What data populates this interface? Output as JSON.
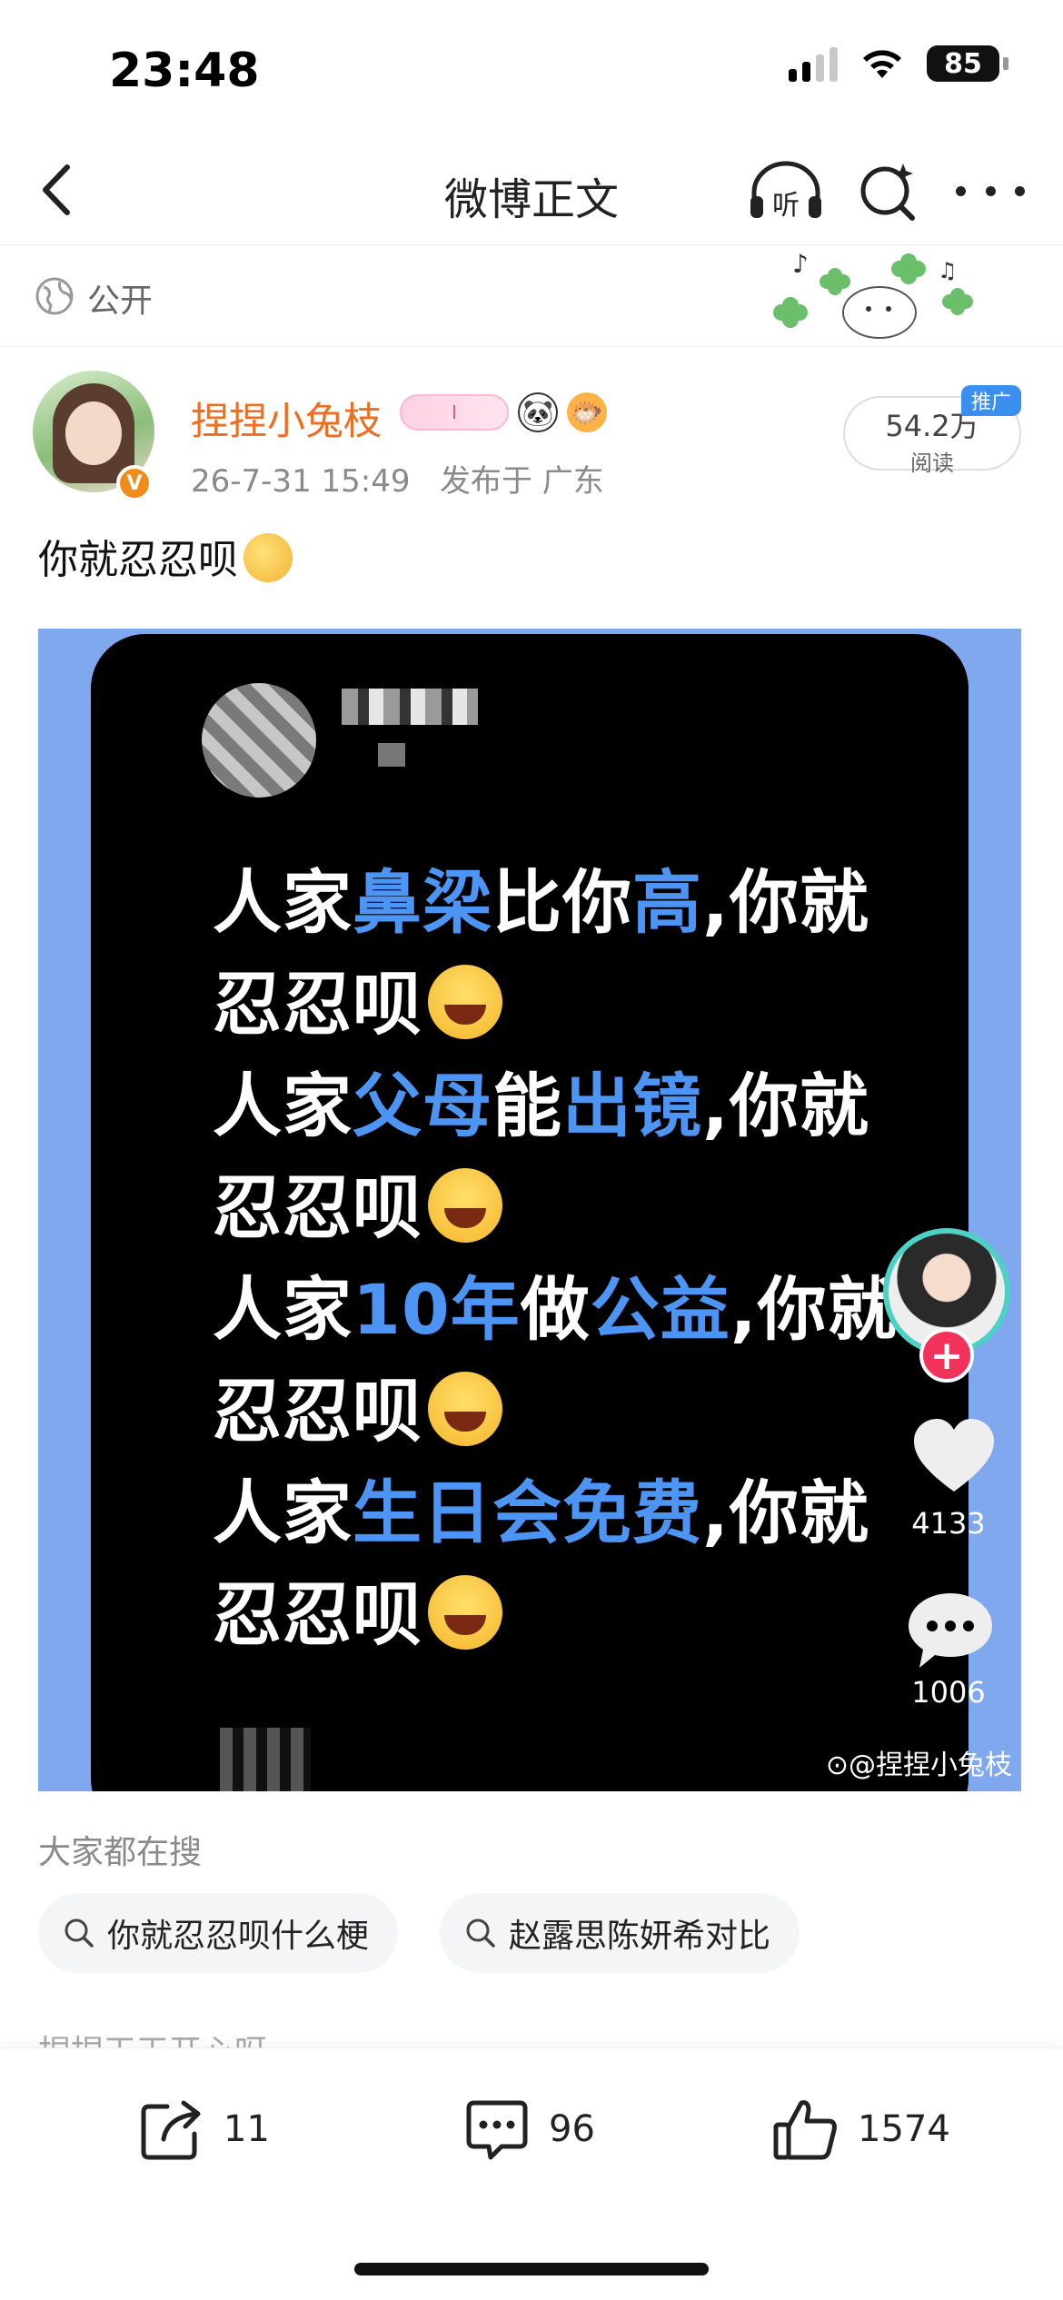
{
  "status": {
    "time": "23:48",
    "battery": "85"
  },
  "nav": {
    "title": "微博正文"
  },
  "visibility": {
    "label": "公开"
  },
  "author": {
    "name": "捏捏小兔枝",
    "pill_text": "I",
    "timestamp": "26-7-31 15:49",
    "location": "发布于 广东",
    "reads": "54.2万",
    "reads_label": "阅读",
    "promo_tag": "推广"
  },
  "post": {
    "text": "你就忍忍呗"
  },
  "image": {
    "lines": [
      [
        {
          "t": "人家"
        },
        {
          "t": "鼻梁",
          "blue": true
        },
        {
          "t": "比你"
        },
        {
          "t": "高",
          "blue": true
        },
        {
          "t": ",你就"
        }
      ],
      [
        {
          "t": "忍忍呗"
        },
        {
          "laugh": true
        }
      ],
      [
        {
          "t": "人家"
        },
        {
          "t": "父母",
          "blue": true
        },
        {
          "t": "能"
        },
        {
          "t": "出镜",
          "blue": true
        },
        {
          "t": ",你就"
        }
      ],
      [
        {
          "t": "忍忍呗"
        },
        {
          "laugh": true
        }
      ],
      [
        {
          "t": "人家"
        },
        {
          "t": "10年",
          "blue": true
        },
        {
          "t": "做"
        },
        {
          "t": "公益",
          "blue": true
        },
        {
          "t": ",你就"
        }
      ],
      [
        {
          "t": "忍忍呗"
        },
        {
          "laugh": true
        }
      ],
      [
        {
          "t": "人家"
        },
        {
          "t": "生日会免费",
          "blue": true
        },
        {
          "t": ",你就"
        }
      ],
      [
        {
          "t": "忍忍呗"
        },
        {
          "laugh": true
        }
      ]
    ],
    "likes": "4133",
    "comments": "1006",
    "watermark": "@捏捏小兔枝"
  },
  "search": {
    "heading": "大家都在搜",
    "chips": [
      "你就忍忍呗什么梗",
      "赵露思陈妍希对比"
    ],
    "partial": "捏捏天天开心呀"
  },
  "actions": {
    "reposts": "11",
    "comments": "96",
    "likes": "1574"
  },
  "icons": [
    "back-icon",
    "headphones-icon",
    "search-icon",
    "more-icon",
    "globe-icon",
    "heart-icon",
    "comment-icon",
    "repost-icon",
    "thumbs-up-icon"
  ]
}
